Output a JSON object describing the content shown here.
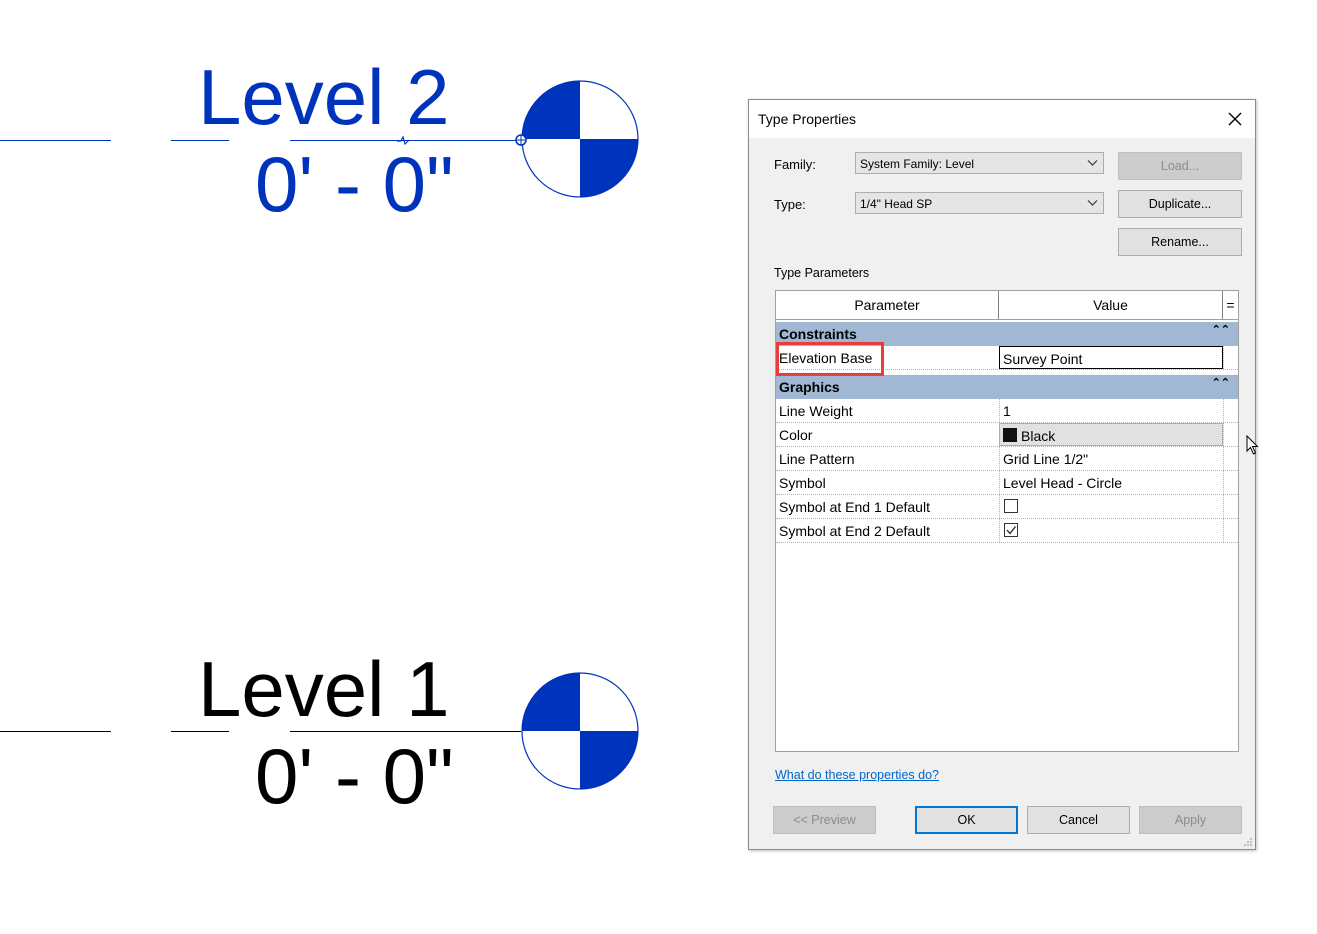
{
  "canvas": {
    "level2": {
      "name": "Level 2",
      "elevation": "0' - 0\"",
      "color": "#0033bb"
    },
    "level1": {
      "name": "Level 1",
      "elevation": "0' - 0\"",
      "color": "#000000"
    }
  },
  "dialog": {
    "title": "Type Properties",
    "family_label": "Family:",
    "family_value": "System Family: Level",
    "type_label": "Type:",
    "type_value": "1/4\" Head SP",
    "load_label": "Load...",
    "duplicate_label": "Duplicate...",
    "rename_label": "Rename...",
    "type_parameters_label": "Type Parameters",
    "grid": {
      "col_parameter": "Parameter",
      "col_value": "Value",
      "col_equals": "=",
      "categories": [
        {
          "name": "Constraints",
          "rows": [
            {
              "parameter": "Elevation Base",
              "value": "Survey Point"
            }
          ]
        },
        {
          "name": "Graphics",
          "rows": [
            {
              "parameter": "Line Weight",
              "value": "1"
            },
            {
              "parameter": "Color",
              "value": "Black"
            },
            {
              "parameter": "Line Pattern",
              "value": "Grid Line 1/2\""
            },
            {
              "parameter": "Symbol",
              "value": "Level Head - Circle"
            },
            {
              "parameter": "Symbol at End 1 Default",
              "checked": false
            },
            {
              "parameter": "Symbol at End 2 Default",
              "checked": true
            }
          ]
        }
      ]
    },
    "help_link": "What do these properties do?",
    "preview_label": "<< Preview",
    "ok_label": "OK",
    "cancel_label": "Cancel",
    "apply_label": "Apply"
  },
  "colors": {
    "selected_level": "#0033bb",
    "category_band": "#a0b8d3",
    "highlight_box": "#e83d3d"
  }
}
